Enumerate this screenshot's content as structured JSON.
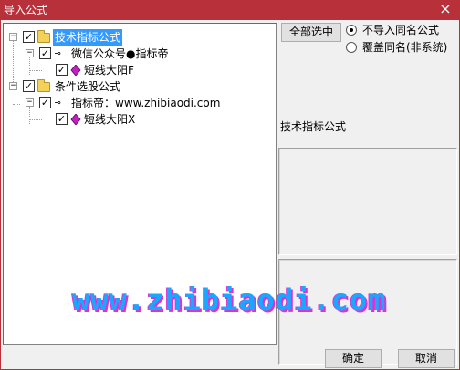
{
  "window": {
    "title": "导入公式",
    "close_glyph": "×"
  },
  "tree": [
    {
      "label": "技术指标公式",
      "checked": true,
      "selected": true,
      "icon": "folder-icon",
      "expander": "−"
    },
    {
      "label": "微信公众号●指标帝",
      "checked": true,
      "icon": "key-icon",
      "expander": "−"
    },
    {
      "label": "短线大阳F",
      "checked": true,
      "icon": "formula-icon"
    },
    {
      "label": "条件选股公式",
      "checked": true,
      "icon": "folder-icon",
      "expander": "−"
    },
    {
      "label": "指标帝：www.zhibiaodi.com",
      "checked": true,
      "icon": "key-icon",
      "expander": "−"
    },
    {
      "label": "短线大阳X",
      "checked": true,
      "icon": "formula-icon"
    }
  ],
  "select_all_label": "全部选中",
  "options": [
    {
      "label": "不导入同名公式",
      "selected": true
    },
    {
      "label": "覆盖同名(非系统)",
      "selected": false
    }
  ],
  "info_label": "技术指标公式",
  "watermark": "www.zhibiaodi.com",
  "ok_label": "确定",
  "cancel_label": "取消",
  "check_glyph": "✓",
  "key_glyph": "⊸",
  "colors": {
    "titlebar": "#b8303a",
    "selection": "#3399ff",
    "formula_icon": "#c020c0",
    "watermark": "#18a8ff"
  }
}
